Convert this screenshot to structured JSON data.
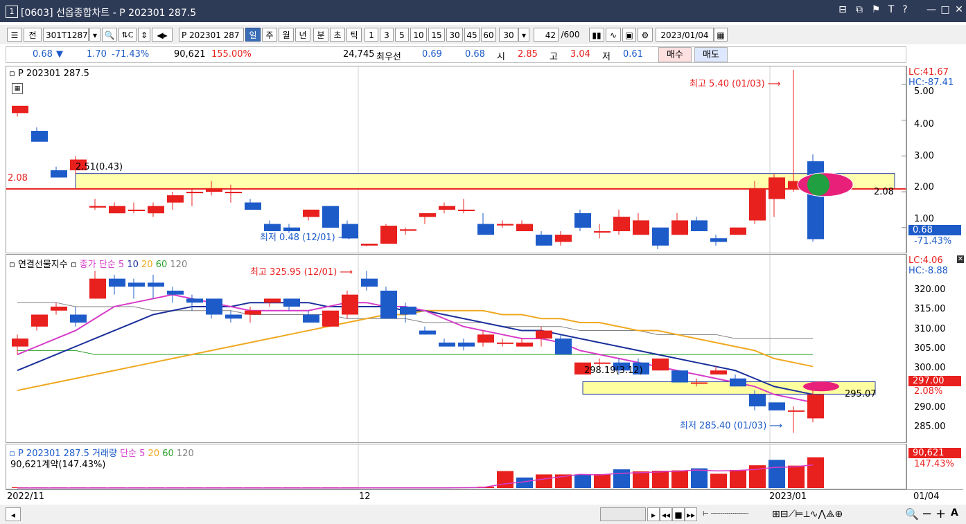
{
  "window": {
    "num": "1",
    "title": "[0603] 선옵종합차트 - P 202301 287.5",
    "buttons": [
      "⊟",
      "⧉",
      "Ƭ",
      "T",
      "?",
      "|",
      "—",
      "□",
      "✕"
    ]
  },
  "toolbar": {
    "full_label": "전",
    "code": "301T1287",
    "name": "P 202301 287",
    "periods": [
      "일",
      "주",
      "월",
      "년",
      "분",
      "초",
      "틱"
    ],
    "selected_period": "일",
    "intervals": [
      "1",
      "3",
      "5",
      "10",
      "15",
      "30",
      "45",
      "60"
    ],
    "interval_value": "30",
    "count": "42",
    "count_max": "/600",
    "date": "2023/01/04"
  },
  "info": {
    "price": "0.68",
    "arrow": "▼",
    "change": "1.70",
    "change_pct": "-71.43%",
    "volume": "90,621",
    "volume_pct": "155.00%",
    "open_interest": "24,745",
    "best_label": "최우선",
    "best_ask": "0.69",
    "best_bid": "0.68",
    "open_label": "시",
    "open": "2.85",
    "high_label": "고",
    "high": "3.04",
    "low_label": "저",
    "low": "0.61",
    "buy": "매수",
    "sell": "매도"
  },
  "pane1": {
    "title": "P 202301 287.5",
    "lc": "LC:41.67",
    "hc": "HC:-87.41",
    "high_note": "최고 5.40 (01/03)",
    "low_note": "최저 0.48 (12/01)",
    "box_label": "2.51(0.43)",
    "left_level": "2.08",
    "right_level": "2.08",
    "last": "0.68",
    "last_pct": "-71.43%",
    "ticks": [
      "5.00",
      "4.00",
      "3.00",
      "2.00",
      "1.00"
    ]
  },
  "pane2": {
    "title": "연결선물지수",
    "ma_label": "종가 단순",
    "ma_periods": [
      "5",
      "10",
      "20",
      "60",
      "120"
    ],
    "lc": "LC:4.06",
    "hc": "HC:-8.88",
    "high_note": "최고 325.95 (12/01)",
    "low_note": "최저 285.40 (01/03)",
    "box_label": "298.19(3.12)",
    "right_level": "295.07",
    "last": "297.00",
    "last_pct": "2.08%",
    "ticks": [
      "320.00",
      "315.00",
      "310.00",
      "305.00",
      "300.00",
      "290.00",
      "285.00"
    ]
  },
  "pane3": {
    "title": "P 202301 287.5 거래량",
    "ma_label": "단순",
    "ma_periods": [
      "5",
      "20",
      "60",
      "120"
    ],
    "volume_note": "90,621계약(147.43%)",
    "last": "90,621",
    "last_pct": "147.43%"
  },
  "xaxis": {
    "labels": [
      "2022/11",
      "12",
      "2023/01"
    ],
    "last_date": "01/04"
  },
  "colors": {
    "up": "#e8201e",
    "down": "#1d5bc9",
    "ma5": "#d63cc8",
    "ma10": "#1a2f9a",
    "ma20": "#f0a820",
    "ma60": "#2aa02a",
    "ma120": "#808080"
  },
  "chart_data": [
    {
      "type": "candlestick",
      "title": "P 202301 287.5",
      "ylim": [
        0.3,
        5.5
      ],
      "candles": [
        {
          "o": 4.2,
          "h": 4.4,
          "l": 4.1,
          "c": 4.4
        },
        {
          "o": 3.7,
          "h": 3.8,
          "l": 3.4,
          "c": 3.4
        },
        {
          "o": 2.6,
          "h": 2.7,
          "l": 2.4,
          "c": 2.4
        },
        {
          "o": 2.6,
          "h": 3.0,
          "l": 2.5,
          "c": 2.9
        },
        {
          "o": 1.6,
          "h": 1.8,
          "l": 1.5,
          "c": 1.6
        },
        {
          "o": 1.4,
          "h": 1.7,
          "l": 1.4,
          "c": 1.6
        },
        {
          "o": 1.5,
          "h": 1.7,
          "l": 1.4,
          "c": 1.5
        },
        {
          "o": 1.4,
          "h": 1.7,
          "l": 1.3,
          "c": 1.6
        },
        {
          "o": 1.7,
          "h": 2.0,
          "l": 1.5,
          "c": 1.9
        },
        {
          "o": 2.0,
          "h": 2.1,
          "l": 1.6,
          "c": 2.0
        },
        {
          "o": 2.0,
          "h": 2.3,
          "l": 1.9,
          "c": 2.1
        },
        {
          "o": 2.0,
          "h": 2.2,
          "l": 1.7,
          "c": 2.0
        },
        {
          "o": 1.7,
          "h": 1.8,
          "l": 1.5,
          "c": 1.5
        },
        {
          "o": 1.1,
          "h": 1.2,
          "l": 0.9,
          "c": 0.9
        },
        {
          "o": 1.0,
          "h": 1.1,
          "l": 0.85,
          "c": 0.9
        },
        {
          "o": 1.3,
          "h": 1.5,
          "l": 1.2,
          "c": 1.5
        },
        {
          "o": 1.6,
          "h": 1.6,
          "l": 1.0,
          "c": 1.0
        },
        {
          "o": 1.1,
          "h": 1.2,
          "l": 0.7,
          "c": 0.7
        },
        {
          "o": 0.5,
          "h": 0.55,
          "l": 0.48,
          "c": 0.55
        },
        {
          "o": 0.55,
          "h": 1.1,
          "l": 0.55,
          "c": 1.05
        },
        {
          "o": 0.95,
          "h": 1.0,
          "l": 0.8,
          "c": 0.95
        },
        {
          "o": 1.3,
          "h": 1.4,
          "l": 1.1,
          "c": 1.4
        },
        {
          "o": 1.5,
          "h": 1.7,
          "l": 1.4,
          "c": 1.6
        },
        {
          "o": 1.5,
          "h": 1.8,
          "l": 1.4,
          "c": 1.5
        },
        {
          "o": 1.1,
          "h": 1.4,
          "l": 0.8,
          "c": 0.8
        },
        {
          "o": 1.1,
          "h": 1.2,
          "l": 1.0,
          "c": 1.1
        },
        {
          "o": 0.9,
          "h": 1.2,
          "l": 0.9,
          "c": 1.1
        },
        {
          "o": 0.8,
          "h": 0.9,
          "l": 0.5,
          "c": 0.5
        },
        {
          "o": 0.6,
          "h": 0.9,
          "l": 0.5,
          "c": 0.8
        },
        {
          "o": 1.4,
          "h": 1.5,
          "l": 0.9,
          "c": 1.0
        },
        {
          "o": 0.9,
          "h": 1.1,
          "l": 0.7,
          "c": 0.9
        },
        {
          "o": 0.9,
          "h": 1.5,
          "l": 0.8,
          "c": 1.3
        },
        {
          "o": 0.8,
          "h": 1.4,
          "l": 0.8,
          "c": 1.2
        },
        {
          "o": 1.0,
          "h": 1.0,
          "l": 0.4,
          "c": 0.5
        },
        {
          "o": 0.8,
          "h": 1.4,
          "l": 0.8,
          "c": 1.2
        },
        {
          "o": 1.2,
          "h": 1.3,
          "l": 0.9,
          "c": 0.9
        },
        {
          "o": 0.7,
          "h": 0.8,
          "l": 0.5,
          "c": 0.6
        },
        {
          "o": 0.8,
          "h": 1.0,
          "l": 0.8,
          "c": 1.0
        },
        {
          "o": 1.2,
          "h": 2.3,
          "l": 1.1,
          "c": 2.1
        },
        {
          "o": 1.8,
          "h": 2.5,
          "l": 1.3,
          "c": 2.4
        },
        {
          "o": 2.1,
          "h": 5.4,
          "l": 2.0,
          "c": 2.3
        },
        {
          "o": 2.85,
          "h": 3.04,
          "l": 0.61,
          "c": 0.68
        }
      ]
    },
    {
      "type": "candlestick",
      "title": "연결선물지수",
      "ylim": [
        283,
        330
      ],
      "candles": [
        {
          "o": 307,
          "h": 310,
          "l": 305,
          "c": 309
        },
        {
          "o": 312,
          "h": 315,
          "l": 311,
          "c": 315
        },
        {
          "o": 316,
          "h": 318,
          "l": 315,
          "c": 317
        },
        {
          "o": 315,
          "h": 317,
          "l": 312,
          "c": 313
        },
        {
          "o": 319,
          "h": 326,
          "l": 319,
          "c": 324
        },
        {
          "o": 324,
          "h": 325,
          "l": 320,
          "c": 322
        },
        {
          "o": 323,
          "h": 324,
          "l": 319,
          "c": 322
        },
        {
          "o": 323,
          "h": 325,
          "l": 319,
          "c": 322
        },
        {
          "o": 321,
          "h": 322,
          "l": 318,
          "c": 320
        },
        {
          "o": 319,
          "h": 320,
          "l": 316,
          "c": 318
        },
        {
          "o": 319,
          "h": 319,
          "l": 314,
          "c": 315
        },
        {
          "o": 315,
          "h": 316,
          "l": 313,
          "c": 314
        },
        {
          "o": 315,
          "h": 317,
          "l": 313,
          "c": 316
        },
        {
          "o": 318,
          "h": 319,
          "l": 317,
          "c": 319
        },
        {
          "o": 319,
          "h": 319,
          "l": 316,
          "c": 317
        },
        {
          "o": 315,
          "h": 316,
          "l": 313,
          "c": 313
        },
        {
          "o": 312,
          "h": 316,
          "l": 312,
          "c": 316
        },
        {
          "o": 315,
          "h": 321,
          "l": 314,
          "c": 320
        },
        {
          "o": 324,
          "h": 326,
          "l": 321,
          "c": 322
        },
        {
          "o": 321,
          "h": 322,
          "l": 314,
          "c": 314
        },
        {
          "o": 317,
          "h": 318,
          "l": 313,
          "c": 315
        },
        {
          "o": 311,
          "h": 312,
          "l": 310,
          "c": 310
        },
        {
          "o": 308,
          "h": 309,
          "l": 307,
          "c": 307
        },
        {
          "o": 308,
          "h": 309,
          "l": 306,
          "c": 307
        },
        {
          "o": 308,
          "h": 311,
          "l": 307,
          "c": 310
        },
        {
          "o": 308,
          "h": 309,
          "l": 307,
          "c": 308
        },
        {
          "o": 307,
          "h": 309,
          "l": 307,
          "c": 308
        },
        {
          "o": 309,
          "h": 312,
          "l": 307,
          "c": 311
        },
        {
          "o": 309,
          "h": 310,
          "l": 305,
          "c": 305
        },
        {
          "o": 300,
          "h": 303,
          "l": 300,
          "c": 303
        },
        {
          "o": 303,
          "h": 304,
          "l": 302,
          "c": 303
        },
        {
          "o": 303,
          "h": 304,
          "l": 300,
          "c": 301
        },
        {
          "o": 303,
          "h": 304,
          "l": 300,
          "c": 300
        },
        {
          "o": 301,
          "h": 304,
          "l": 301,
          "c": 304
        },
        {
          "o": 301,
          "h": 301,
          "l": 298,
          "c": 298
        },
        {
          "o": 298,
          "h": 299,
          "l": 297,
          "c": 298
        },
        {
          "o": 300,
          "h": 302,
          "l": 300,
          "c": 301
        },
        {
          "o": 299,
          "h": 300,
          "l": 297,
          "c": 297
        },
        {
          "o": 295,
          "h": 296,
          "l": 291,
          "c": 292
        },
        {
          "o": 293,
          "h": 293,
          "l": 291,
          "c": 291
        },
        {
          "o": 291,
          "h": 292,
          "l": 285.4,
          "c": 291
        },
        {
          "o": 289,
          "h": 297,
          "l": 288,
          "c": 295
        }
      ],
      "ma5": [
        305,
        307,
        309,
        311,
        314,
        317,
        318,
        319,
        320,
        319,
        318,
        317,
        316,
        316,
        316,
        316,
        317,
        318,
        318,
        317,
        317,
        316,
        314,
        312,
        311,
        310,
        309,
        309,
        308,
        306,
        305,
        304,
        303,
        302,
        301,
        300,
        299,
        298,
        297,
        295,
        294,
        293
      ],
      "ma10": [
        301,
        303,
        305,
        307,
        309,
        311,
        313,
        315,
        316,
        317,
        317,
        317,
        318,
        318,
        318,
        318,
        317,
        317,
        317,
        317,
        316,
        316,
        315,
        314,
        313,
        312,
        311,
        311,
        310,
        309,
        308,
        307,
        306,
        305,
        304,
        303,
        302,
        301,
        299,
        297,
        296,
        295
      ],
      "ma20": [
        296,
        297,
        298,
        299,
        300,
        301,
        302,
        303,
        304,
        305,
        306,
        307,
        308,
        309,
        310,
        311,
        312,
        313,
        314,
        315,
        315,
        316,
        316,
        316,
        316,
        315,
        315,
        314,
        314,
        313,
        313,
        312,
        311,
        311,
        310,
        309,
        308,
        307,
        306,
        304,
        303,
        302
      ],
      "ma60": [
        306,
        306,
        306,
        306,
        305,
        305,
        305,
        305,
        305,
        305,
        305,
        305,
        305,
        305,
        305,
        305,
        305,
        305,
        305,
        305,
        305,
        305,
        305,
        305,
        305,
        305,
        305,
        305,
        305,
        305,
        305,
        305,
        305,
        305,
        305,
        305,
        305,
        305,
        305,
        305,
        305,
        305
      ],
      "ma120": [
        318,
        318,
        318,
        317,
        317,
        317,
        317,
        316,
        316,
        316,
        316,
        316,
        315,
        315,
        315,
        315,
        315,
        314,
        314,
        314,
        314,
        313,
        313,
        313,
        313,
        312,
        312,
        312,
        312,
        311,
        311,
        311,
        311,
        310,
        310,
        310,
        310,
        309,
        309,
        309,
        309,
        309
      ]
    },
    {
      "type": "bar",
      "title": "P 202301 287.5 거래량",
      "ylim": [
        0,
        100000
      ],
      "values": [
        300,
        300,
        300,
        300,
        300,
        300,
        300,
        300,
        300,
        300,
        300,
        300,
        300,
        300,
        300,
        300,
        600,
        300,
        600,
        600,
        600,
        600,
        700,
        2000,
        4000,
        50000,
        31000,
        40000,
        40000,
        40000,
        41000,
        55000,
        49000,
        51000,
        52000,
        58000,
        42000,
        53000,
        67000,
        83000,
        66000,
        72000,
        90621
      ],
      "up": [
        true,
        true,
        true,
        true,
        true,
        true,
        true,
        true,
        true,
        true,
        true,
        true,
        true,
        true,
        true,
        true,
        true,
        true,
        true,
        true,
        true,
        true,
        true,
        true,
        true,
        true,
        false,
        true,
        true,
        false,
        true,
        false,
        true,
        true,
        true,
        false,
        true,
        true,
        true,
        false,
        true,
        true
      ]
    }
  ]
}
